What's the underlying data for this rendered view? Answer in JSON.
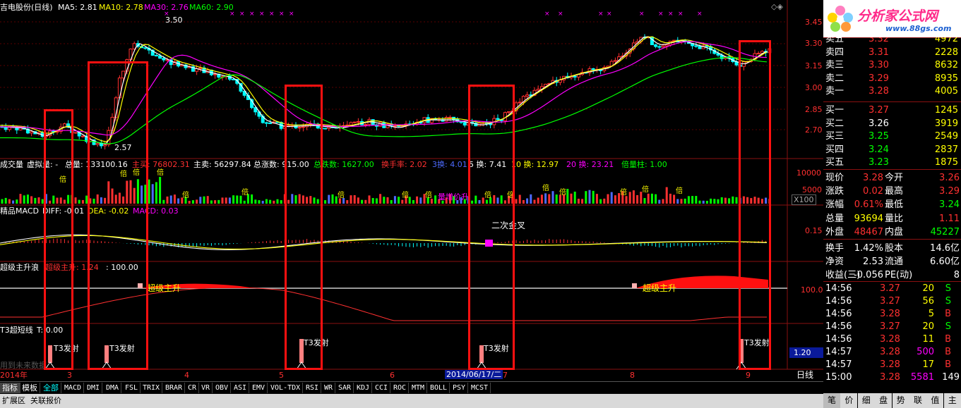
{
  "colors": {
    "up": "#ff3030",
    "down": "#00ffff",
    "ma5": "#ffffff",
    "ma10": "#ffff00",
    "ma30": "#ff00ff",
    "ma60": "#00ff00",
    "highlight": "#ff1010"
  },
  "header": {
    "title": "吉电股份(日线)",
    "ma5": "MA5: 2.81",
    "ma10": "MA10: 2.78",
    "ma30": "MA30: 2.76",
    "ma60": "MA60: 2.90"
  },
  "annotations": {
    "high": "3.50",
    "low": "2.57",
    "cross2": "二次金叉",
    "chaoji1": "超级主升",
    "chaoji2": "超级主升",
    "xinzeng": "量增价升",
    "bei": "倍",
    "t3": "T3发射"
  },
  "price_axis": [
    "3.45",
    "3.30",
    "3.15",
    "3.00",
    "2.85",
    "2.70"
  ],
  "volume": {
    "label": "成交量",
    "virtual": "虚拟量: -",
    "total": "总量: 133100.16",
    "active_buy": "主买: 76802.31",
    "active_sell": "主卖: 56297.84",
    "rise": "总涨数: 915.00",
    "fall": "总跌数: 1627.00",
    "turnover": "换手率: 2.02",
    "h3": "3换: 4.01",
    "h5": "5 换: 7.41",
    "h10": "10 换: 12.97",
    "h20": "20 换: 23.21",
    "bei": "倍量柱: 1.00",
    "axis": [
      "10000",
      "5000"
    ],
    "unit": "X100"
  },
  "macd": {
    "label": "精品MACD",
    "diff": "DIFF: -0.01",
    "dea": "DEA: -0.02",
    "macd": "MACD: 0.03",
    "axis": "0.15"
  },
  "csz": {
    "label": "超级主升浪",
    "line": "超级主升: 1.24",
    "val": ": 100.00",
    "axis": "100.0"
  },
  "t3": {
    "label": "T3超短线",
    "val": "T: 0.00",
    "axis": "1.20"
  },
  "future": "用到未来数据",
  "dates": {
    "year": "2014年",
    "m3": "3",
    "m4": "4",
    "m5": "5",
    "m6": "6",
    "current": "2014/06/17/二",
    "m7": "7",
    "m8": "8",
    "m9": "9",
    "period": "日线"
  },
  "tabs": [
    "指标",
    "模板",
    "全部",
    "MACD",
    "DMI",
    "DMA",
    "FSL",
    "TRIX",
    "BRAR",
    "CR",
    "VR",
    "OBV",
    "ASI",
    "EMV",
    "VOL-TDX",
    "RSI",
    "WR",
    "SAR",
    "KDJ",
    "CCI",
    "ROC",
    "MTM",
    "BOLL",
    "PSY",
    "MCST"
  ],
  "tabs2": [
    "扩展区",
    "关联报价"
  ],
  "logo": {
    "name": "分析家公式网",
    "url": "www.88gs.com"
  },
  "orderbook": {
    "sell": [
      {
        "l": "卖五",
        "p": "3.32",
        "v": "4972"
      },
      {
        "l": "卖四",
        "p": "3.31",
        "v": "2228"
      },
      {
        "l": "卖三",
        "p": "3.30",
        "v": "8632"
      },
      {
        "l": "卖二",
        "p": "3.29",
        "v": "8935"
      },
      {
        "l": "卖一",
        "p": "3.28",
        "v": "4005"
      }
    ],
    "buy": [
      {
        "l": "买一",
        "p": "3.27",
        "v": "1245"
      },
      {
        "l": "买二",
        "p": "3.26",
        "v": "3919"
      },
      {
        "l": "买三",
        "p": "3.25",
        "v": "2549"
      },
      {
        "l": "买四",
        "p": "3.24",
        "v": "2837"
      },
      {
        "l": "买五",
        "p": "3.23",
        "v": "1875"
      }
    ]
  },
  "stats": [
    {
      "a": "现价",
      "b": "3.28",
      "c": "今开",
      "d": "3.26"
    },
    {
      "a": "涨跌",
      "b": "0.02",
      "c": "最高",
      "d": "3.29"
    },
    {
      "a": "涨幅",
      "b": "0.61%",
      "c": "最低",
      "d": "3.24"
    },
    {
      "a": "总量",
      "b": "93694",
      "c": "量比",
      "d": "1.11"
    },
    {
      "a": "外盘",
      "b": "48467",
      "c": "内盘",
      "d": "45227"
    },
    {
      "a": "换手",
      "b": "1.42%",
      "c": "股本",
      "d": "14.6亿"
    },
    {
      "a": "净资",
      "b": "2.53",
      "c": "流通",
      "d": "6.60亿"
    },
    {
      "a": "收益(三)",
      "b": "-0.056",
      "c": "PE(动)",
      "d": "8"
    }
  ],
  "ticks": [
    {
      "t": "14:56",
      "p": "3.27",
      "v": "20",
      "s": "S"
    },
    {
      "t": "14:56",
      "p": "3.27",
      "v": "56",
      "s": "S"
    },
    {
      "t": "14:56",
      "p": "3.28",
      "v": "5",
      "s": "B"
    },
    {
      "t": "14:56",
      "p": "3.27",
      "v": "20",
      "s": "S"
    },
    {
      "t": "14:56",
      "p": "3.28",
      "v": "11",
      "s": "B"
    },
    {
      "t": "14:57",
      "p": "3.28",
      "v": "500",
      "s": "B"
    },
    {
      "t": "14:57",
      "p": "3.28",
      "v": "17",
      "s": "B"
    },
    {
      "t": "15:00",
      "p": "3.28",
      "v": "5581",
      "s": "149"
    }
  ],
  "bottom_tabs": [
    "笔",
    "价",
    "细",
    "盘",
    "势",
    "联",
    "值",
    "主"
  ]
}
